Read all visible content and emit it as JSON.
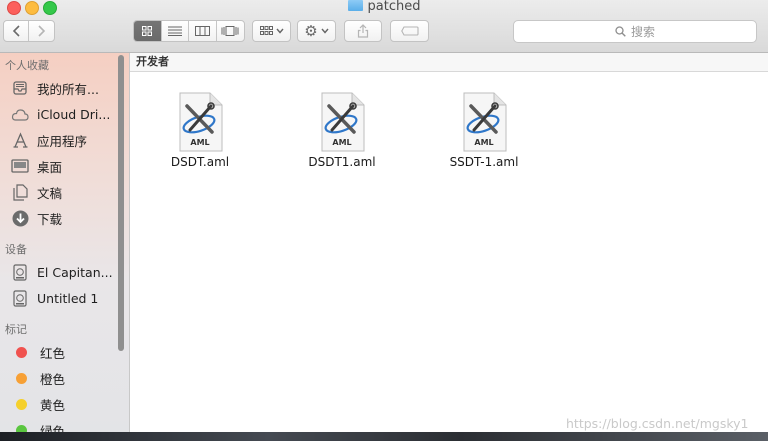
{
  "window": {
    "title": "patched"
  },
  "toolbar": {
    "back_icon": "chevron-left-icon",
    "forward_icon": "chevron-right-icon",
    "views": [
      "icon-view-icon",
      "list-view-icon",
      "column-view-icon",
      "coverflow-view-icon"
    ],
    "arrange_icon": "grid-arrange-icon",
    "action_icon": "gear-icon",
    "share_icon": "share-icon",
    "tag_icon": "tag-icon",
    "search_placeholder": "搜索"
  },
  "sidebar": {
    "favorites_header": "个人收藏",
    "favorites": [
      {
        "label": "我的所有...",
        "icon": "all-files-icon"
      },
      {
        "label": "iCloud Dri...",
        "icon": "cloud-icon"
      },
      {
        "label": "应用程序",
        "icon": "applications-icon"
      },
      {
        "label": "桌面",
        "icon": "desktop-icon"
      },
      {
        "label": "文稿",
        "icon": "documents-icon"
      },
      {
        "label": "下载",
        "icon": "download-icon"
      }
    ],
    "devices_header": "设备",
    "devices": [
      {
        "label": "El Capitan...",
        "icon": "disk-icon"
      },
      {
        "label": "Untitled 1",
        "icon": "disk-icon"
      }
    ],
    "tags_header": "标记",
    "tags": [
      {
        "label": "红色",
        "color": "#f0524f"
      },
      {
        "label": "橙色",
        "color": "#f7a035"
      },
      {
        "label": "黄色",
        "color": "#f5d02c"
      },
      {
        "label": "绿色",
        "color": "#5ac640"
      }
    ]
  },
  "content": {
    "group_header": "开发者",
    "files": [
      {
        "name": "DSDT.aml",
        "badge": "AML"
      },
      {
        "name": "DSDT1.aml",
        "badge": "AML"
      },
      {
        "name": "SSDT-1.aml",
        "badge": "AML"
      }
    ]
  },
  "watermark": "https://blog.csdn.net/mgsky1"
}
